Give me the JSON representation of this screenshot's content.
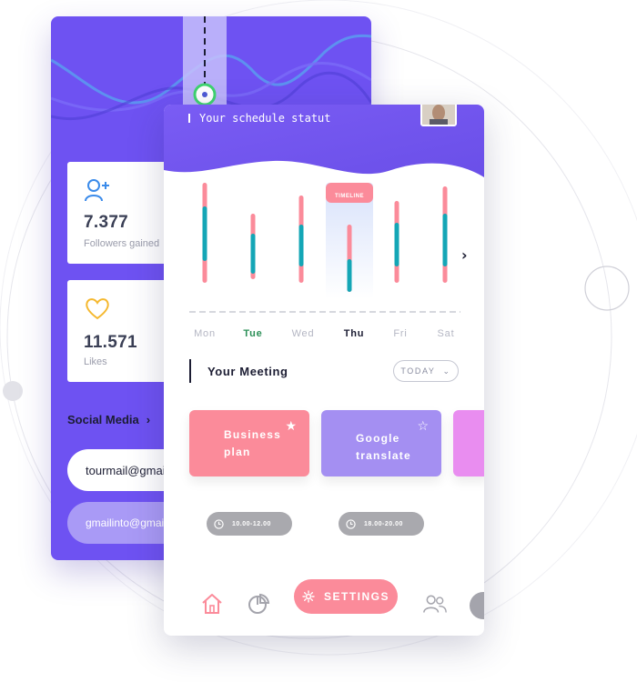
{
  "colors": {
    "primary_purple": "#6e52f2",
    "accent_pink": "#fb8b9a",
    "accent_teal": "#14a6b6",
    "meeting_google": "#a48ff2",
    "meeting_third": "#e98df0",
    "today_green": "#2b8f57",
    "dark_text": "#1c1d33"
  },
  "back_card": {
    "stats": [
      {
        "icon": "user-add-icon",
        "value": "7.377",
        "label": "Followers gained"
      },
      {
        "icon": "heart-icon",
        "value": "11.571",
        "label": "Likes"
      }
    ],
    "social_title": "Social Media",
    "emails": [
      "tourmail@gmail.com",
      "gmailinto@gmail.com"
    ]
  },
  "front_card": {
    "schedule_title": "Your schedule statut",
    "timeline_label": "TIMELINE",
    "days": [
      {
        "label": "Mon",
        "state": "normal"
      },
      {
        "label": "Tue",
        "state": "today"
      },
      {
        "label": "Wed",
        "state": "normal"
      },
      {
        "label": "Thu",
        "state": "active"
      },
      {
        "label": "Fri",
        "state": "normal"
      },
      {
        "label": "Sat",
        "state": "normal"
      }
    ],
    "meeting_title": "Your Meeting",
    "filter_label": "TODAY",
    "meetings": [
      {
        "title": "Business plan",
        "time": "10.00-12.00",
        "starred": true
      },
      {
        "title": "Google translate",
        "time": "18.00-20.00",
        "starred": false
      }
    ],
    "nav": {
      "settings_label": "SETTINGS"
    }
  }
}
